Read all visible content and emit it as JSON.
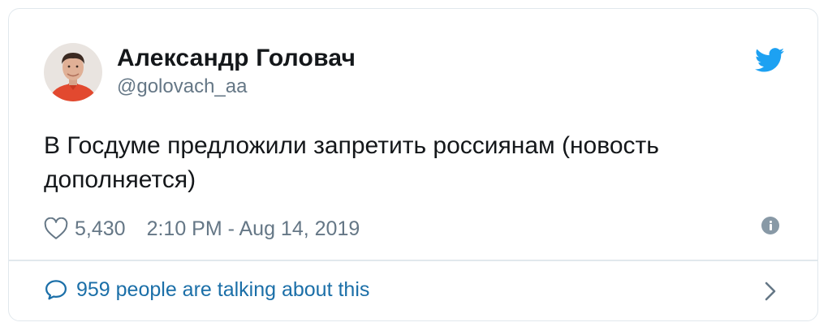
{
  "tweet": {
    "author_name": "Александр Головач",
    "author_handle": "@golovach_aa",
    "text": "В Госдуме предложили запретить россиянам (новость дополняется)",
    "likes": "5,430",
    "timestamp": "2:10 PM - Aug 14, 2019",
    "talking": "959 people are talking about this"
  },
  "icons": {
    "brand": "twitter-bird-icon",
    "like": "heart-icon",
    "info": "info-icon",
    "conversation": "speech-bubble-icon",
    "more": "chevron-right-icon"
  },
  "colors": {
    "twitter_blue": "#1da1f2",
    "link_blue": "#1b6fa8",
    "secondary_text": "#657786",
    "border": "#e1e8ed"
  }
}
